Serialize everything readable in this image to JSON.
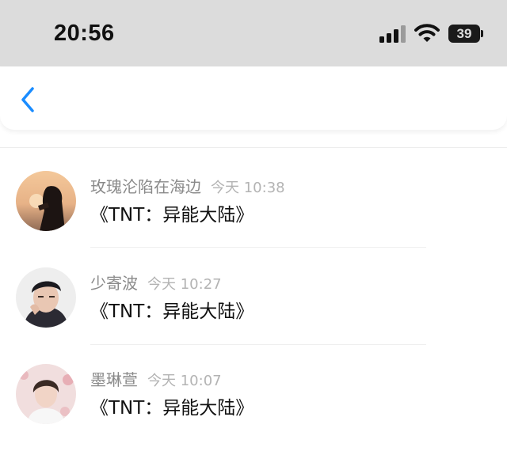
{
  "status_bar": {
    "time": "20:56",
    "battery_level": "39",
    "icons": [
      "cellular-signal-icon",
      "wifi-icon",
      "battery-icon"
    ]
  },
  "nav": {
    "back_icon": "chevron-left-icon",
    "accent_color": "#1a8cff"
  },
  "comments": [
    {
      "username": "玫瑰沦陷在海边",
      "time": "今天 10:38",
      "text": "《TNT：异能大陆》"
    },
    {
      "username": "少寄波",
      "time": "今天 10:27",
      "text": "《TNT：异能大陆》"
    },
    {
      "username": "墨琳萱",
      "time": "今天 10:07",
      "text": "《TNT：异能大陆》"
    }
  ]
}
